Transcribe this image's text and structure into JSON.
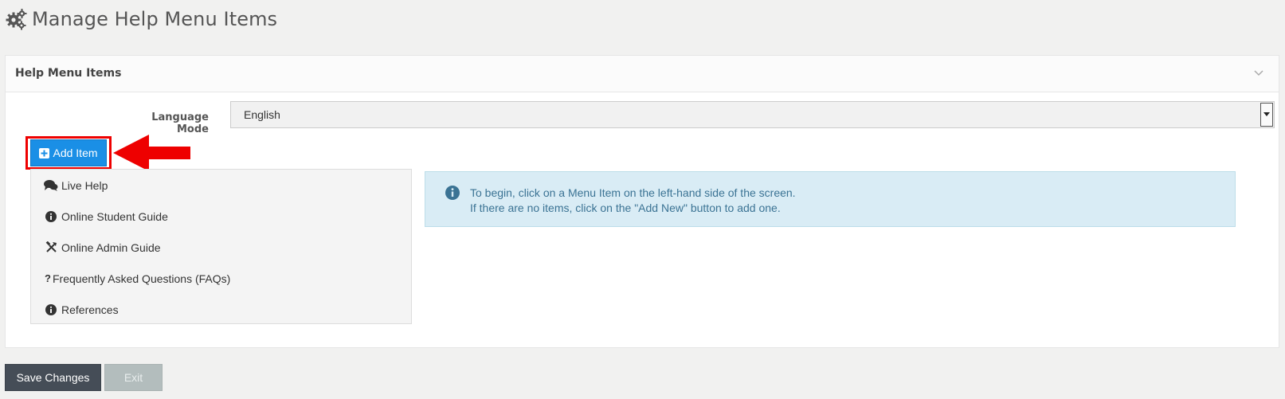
{
  "page": {
    "title": "Manage Help Menu Items"
  },
  "panel": {
    "title": "Help Menu Items",
    "language_label": "Language Mode",
    "language_value": "English"
  },
  "add_item": {
    "label": "Add Item"
  },
  "menu_items": [
    {
      "label": "Live Help",
      "icon": "comments-icon"
    },
    {
      "label": "Online Student Guide",
      "icon": "info-circle-icon"
    },
    {
      "label": "Online Admin Guide",
      "icon": "tools-icon"
    },
    {
      "label": "Frequently Asked Questions (FAQs)",
      "icon": "question-icon"
    },
    {
      "label": "References",
      "icon": "info-circle-icon"
    }
  ],
  "info": {
    "line1": "To begin, click on a Menu Item on the left-hand side of the screen.",
    "line2": "If there are no items, click on the \"Add New\" button to add one."
  },
  "footer": {
    "save_label": "Save Changes",
    "exit_label": "Exit"
  },
  "colors": {
    "accent": "#1a8fe6",
    "highlight": "#ee0000",
    "info_bg": "#d9ecf5",
    "info_text": "#3b7394",
    "save_bg": "#454d57",
    "exit_bg": "#b3bdbd"
  }
}
